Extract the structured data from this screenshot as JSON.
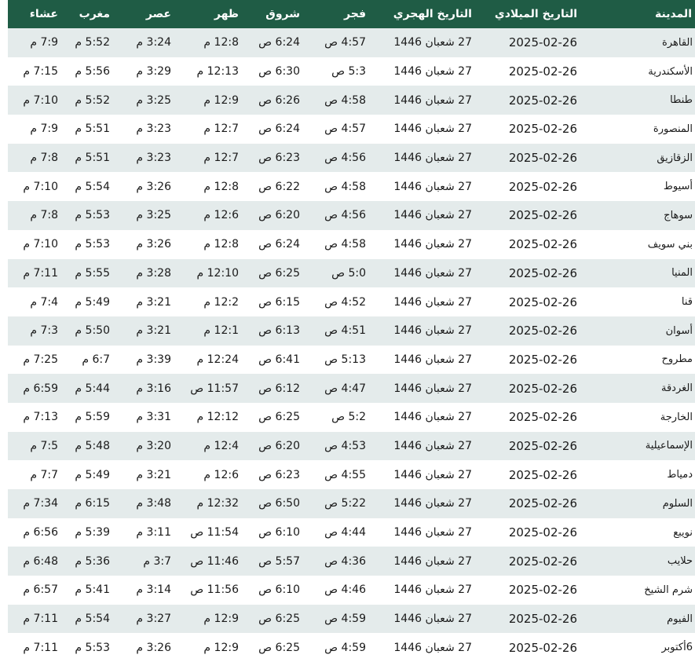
{
  "headers": {
    "city": "المدينة",
    "gregorian": "التاريخ الميلادي",
    "hijri": "التاريخ الهجري",
    "fajr": "فجر",
    "sunrise": "شروق",
    "dhuhr": "ظهر",
    "asr": "عصر",
    "maghrib": "مغرب",
    "isha": "عشاء"
  },
  "rows": [
    {
      "city": "القاهرة",
      "gregorian": "2025-02-26",
      "hijri": "27 شعبان 1446",
      "fajr": "4:57 ص",
      "sunrise": "6:24 ص",
      "dhuhr": "12:8 م",
      "asr": "3:24 م",
      "maghrib": "5:52 م",
      "isha": "7:9 م"
    },
    {
      "city": "الأسكندرية",
      "gregorian": "2025-02-26",
      "hijri": "27 شعبان 1446",
      "fajr": "5:3 ص",
      "sunrise": "6:30 ص",
      "dhuhr": "12:13 م",
      "asr": "3:29 م",
      "maghrib": "5:56 م",
      "isha": "7:15 م"
    },
    {
      "city": "طنطا",
      "gregorian": "2025-02-26",
      "hijri": "27 شعبان 1446",
      "fajr": "4:58 ص",
      "sunrise": "6:26 ص",
      "dhuhr": "12:9 م",
      "asr": "3:25 م",
      "maghrib": "5:52 م",
      "isha": "7:10 م"
    },
    {
      "city": "المنصورة",
      "gregorian": "2025-02-26",
      "hijri": "27 شعبان 1446",
      "fajr": "4:57 ص",
      "sunrise": "6:24 ص",
      "dhuhr": "12:7 م",
      "asr": "3:23 م",
      "maghrib": "5:51 م",
      "isha": "7:9 م"
    },
    {
      "city": "الزقازيق",
      "gregorian": "2025-02-26",
      "hijri": "27 شعبان 1446",
      "fajr": "4:56 ص",
      "sunrise": "6:23 ص",
      "dhuhr": "12:7 م",
      "asr": "3:23 م",
      "maghrib": "5:51 م",
      "isha": "7:8 م"
    },
    {
      "city": "أسيوط",
      "gregorian": "2025-02-26",
      "hijri": "27 شعبان 1446",
      "fajr": "4:58 ص",
      "sunrise": "6:22 ص",
      "dhuhr": "12:8 م",
      "asr": "3:26 م",
      "maghrib": "5:54 م",
      "isha": "7:10 م"
    },
    {
      "city": "سوهاج",
      "gregorian": "2025-02-26",
      "hijri": "27 شعبان 1446",
      "fajr": "4:56 ص",
      "sunrise": "6:20 ص",
      "dhuhr": "12:6 م",
      "asr": "3:25 م",
      "maghrib": "5:53 م",
      "isha": "7:8 م"
    },
    {
      "city": "بني سويف",
      "gregorian": "2025-02-26",
      "hijri": "27 شعبان 1446",
      "fajr": "4:58 ص",
      "sunrise": "6:24 ص",
      "dhuhr": "12:8 م",
      "asr": "3:26 م",
      "maghrib": "5:53 م",
      "isha": "7:10 م"
    },
    {
      "city": "المنيا",
      "gregorian": "2025-02-26",
      "hijri": "27 شعبان 1446",
      "fajr": "5:0 ص",
      "sunrise": "6:25 ص",
      "dhuhr": "12:10 م",
      "asr": "3:28 م",
      "maghrib": "5:55 م",
      "isha": "7:11 م"
    },
    {
      "city": "قنا",
      "gregorian": "2025-02-26",
      "hijri": "27 شعبان 1446",
      "fajr": "4:52 ص",
      "sunrise": "6:15 ص",
      "dhuhr": "12:2 م",
      "asr": "3:21 م",
      "maghrib": "5:49 م",
      "isha": "7:4 م"
    },
    {
      "city": "أسوان",
      "gregorian": "2025-02-26",
      "hijri": "27 شعبان 1446",
      "fajr": "4:51 ص",
      "sunrise": "6:13 ص",
      "dhuhr": "12:1 م",
      "asr": "3:21 م",
      "maghrib": "5:50 م",
      "isha": "7:3 م"
    },
    {
      "city": "مطروح",
      "gregorian": "2025-02-26",
      "hijri": "27 شعبان 1446",
      "fajr": "5:13 ص",
      "sunrise": "6:41 ص",
      "dhuhr": "12:24 م",
      "asr": "3:39 م",
      "maghrib": "6:7 م",
      "isha": "7:25 م"
    },
    {
      "city": "الغردقة",
      "gregorian": "2025-02-26",
      "hijri": "27 شعبان 1446",
      "fajr": "4:47 ص",
      "sunrise": "6:12 ص",
      "dhuhr": "11:57 ص",
      "asr": "3:16 م",
      "maghrib": "5:44 م",
      "isha": "6:59 م"
    },
    {
      "city": "الخارجة",
      "gregorian": "2025-02-26",
      "hijri": "27 شعبان 1446",
      "fajr": "5:2 ص",
      "sunrise": "6:25 ص",
      "dhuhr": "12:12 م",
      "asr": "3:31 م",
      "maghrib": "5:59 م",
      "isha": "7:13 م"
    },
    {
      "city": "الإسماعيلية",
      "gregorian": "2025-02-26",
      "hijri": "27 شعبان 1446",
      "fajr": "4:53 ص",
      "sunrise": "6:20 ص",
      "dhuhr": "12:4 م",
      "asr": "3:20 م",
      "maghrib": "5:48 م",
      "isha": "7:5 م"
    },
    {
      "city": "دمياط",
      "gregorian": "2025-02-26",
      "hijri": "27 شعبان 1446",
      "fajr": "4:55 ص",
      "sunrise": "6:23 ص",
      "dhuhr": "12:6 م",
      "asr": "3:21 م",
      "maghrib": "5:49 م",
      "isha": "7:7 م"
    },
    {
      "city": "السلوم",
      "gregorian": "2025-02-26",
      "hijri": "27 شعبان 1446",
      "fajr": "5:22 ص",
      "sunrise": "6:50 ص",
      "dhuhr": "12:32 م",
      "asr": "3:48 م",
      "maghrib": "6:15 م",
      "isha": "7:34 م"
    },
    {
      "city": "نويبع",
      "gregorian": "2025-02-26",
      "hijri": "27 شعبان 1446",
      "fajr": "4:44 ص",
      "sunrise": "6:10 ص",
      "dhuhr": "11:54 ص",
      "asr": "3:11 م",
      "maghrib": "5:39 م",
      "isha": "6:56 م"
    },
    {
      "city": "حلايب",
      "gregorian": "2025-02-26",
      "hijri": "27 شعبان 1446",
      "fajr": "4:36 ص",
      "sunrise": "5:57 ص",
      "dhuhr": "11:46 ص",
      "asr": "3:7 م",
      "maghrib": "5:36 م",
      "isha": "6:48 م"
    },
    {
      "city": "شرم الشيخ",
      "gregorian": "2025-02-26",
      "hijri": "27 شعبان 1446",
      "fajr": "4:46 ص",
      "sunrise": "6:10 ص",
      "dhuhr": "11:56 ص",
      "asr": "3:14 م",
      "maghrib": "5:41 م",
      "isha": "6:57 م"
    },
    {
      "city": "الفيوم",
      "gregorian": "2025-02-26",
      "hijri": "27 شعبان 1446",
      "fajr": "4:59 ص",
      "sunrise": "6:25 ص",
      "dhuhr": "12:9 م",
      "asr": "3:27 م",
      "maghrib": "5:54 م",
      "isha": "7:11 م"
    },
    {
      "city": "6أكتوبر",
      "gregorian": "2025-02-26",
      "hijri": "27 شعبان 1446",
      "fajr": "4:59 ص",
      "sunrise": "6:25 ص",
      "dhuhr": "12:9 م",
      "asr": "3:26 م",
      "maghrib": "5:53 م",
      "isha": "7:11 م"
    }
  ]
}
